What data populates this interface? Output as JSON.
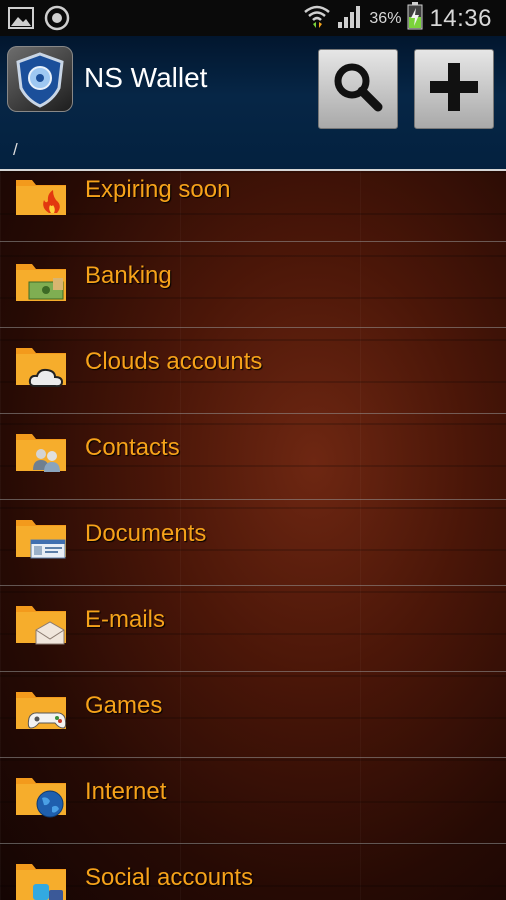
{
  "status_bar": {
    "battery_percent": "36%",
    "time": "14:36"
  },
  "app": {
    "title": "NS Wallet",
    "breadcrumb": "/"
  },
  "colors": {
    "accent_text": "#f6a21a",
    "folder": "#f39a1c",
    "header": "#04213f"
  },
  "folders": [
    {
      "label": "Expiring soon",
      "icon": "fire-icon"
    },
    {
      "label": "Banking",
      "icon": "money-icon"
    },
    {
      "label": "Clouds accounts",
      "icon": "cloud-icon"
    },
    {
      "label": "Contacts",
      "icon": "people-icon"
    },
    {
      "label": "Documents",
      "icon": "id-card-icon"
    },
    {
      "label": "E-mails",
      "icon": "envelope-icon"
    },
    {
      "label": "Games",
      "icon": "gamepad-icon"
    },
    {
      "label": "Internet",
      "icon": "globe-icon"
    },
    {
      "label": "Social accounts",
      "icon": "social-icon"
    }
  ]
}
